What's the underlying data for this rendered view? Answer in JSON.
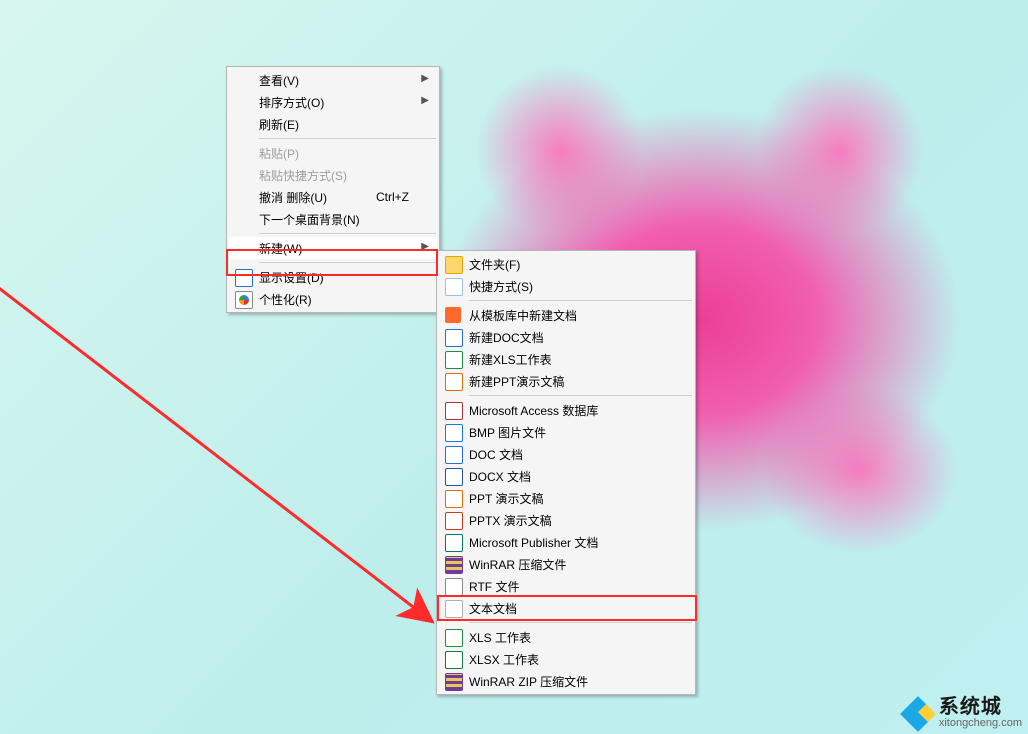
{
  "contextMenu": {
    "items": [
      {
        "label": "查看(V)",
        "submenu": true
      },
      {
        "label": "排序方式(O)",
        "submenu": true
      },
      {
        "label": "刷新(E)"
      },
      {
        "sep": true
      },
      {
        "label": "粘贴(P)",
        "disabled": true
      },
      {
        "label": "粘贴快捷方式(S)",
        "disabled": true
      },
      {
        "label": "撤消 删除(U)",
        "shortcut": "Ctrl+Z"
      },
      {
        "label": "下一个桌面背景(N)"
      },
      {
        "sep": true
      },
      {
        "label": "新建(W)",
        "submenu": true,
        "selected": true
      },
      {
        "sep": true
      },
      {
        "label": "显示设置(D)",
        "icon": "display"
      },
      {
        "label": "个性化(R)",
        "icon": "pers"
      }
    ]
  },
  "newSubMenu": {
    "items": [
      {
        "label": "文件夹(F)",
        "icon": "folder"
      },
      {
        "label": "快捷方式(S)",
        "icon": "link"
      },
      {
        "sep": true
      },
      {
        "label": "从模板库中新建文档",
        "icon": "wps"
      },
      {
        "label": "新建DOC文档",
        "icon": "doc"
      },
      {
        "label": "新建XLS工作表",
        "icon": "xls"
      },
      {
        "label": "新建PPT演示文稿",
        "icon": "ppt"
      },
      {
        "sep": true
      },
      {
        "label": "Microsoft Access 数据库",
        "icon": "acc"
      },
      {
        "label": "BMP 图片文件",
        "icon": "bmp"
      },
      {
        "label": "DOC 文档",
        "icon": "doc"
      },
      {
        "label": "DOCX 文档",
        "icon": "docx"
      },
      {
        "label": "PPT 演示文稿",
        "icon": "ppt"
      },
      {
        "label": "PPTX 演示文稿",
        "icon": "pptx"
      },
      {
        "label": "Microsoft Publisher 文档",
        "icon": "pub"
      },
      {
        "label": "WinRAR 压缩文件",
        "icon": "rar"
      },
      {
        "label": "RTF 文件",
        "icon": "rtf"
      },
      {
        "label": "文本文档",
        "icon": "txt",
        "highlight": true
      },
      {
        "sep": true
      },
      {
        "label": "XLS 工作表",
        "icon": "xls"
      },
      {
        "label": "XLSX 工作表",
        "icon": "xlsx"
      },
      {
        "label": "WinRAR ZIP 压缩文件",
        "icon": "rar"
      }
    ]
  },
  "watermark": {
    "title": "系统城",
    "url": "xitongcheng.com"
  }
}
